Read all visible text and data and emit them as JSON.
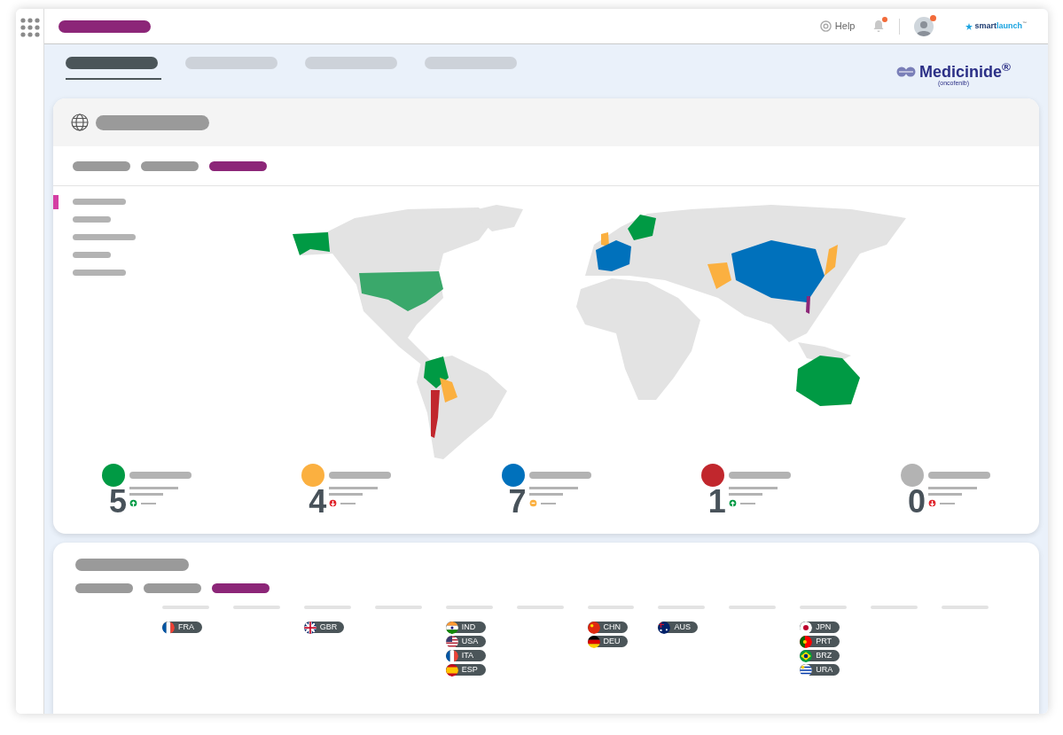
{
  "nav_tabs": [
    {
      "selected": true
    },
    {
      "selected": false
    },
    {
      "selected": false
    },
    {
      "selected": false
    }
  ],
  "top_bar": {
    "help": "Help"
  },
  "partner_logo": {
    "first": "smart",
    "second": "launch",
    "mark": "™"
  },
  "brand": {
    "name": "Medicinide$^{®}$",
    "generic": "(oncofenib)"
  },
  "map_card": {
    "tabs": [
      {
        "selected": false
      },
      {
        "selected": false
      },
      {
        "selected": true
      }
    ],
    "side_list": [
      {
        "selected": true
      },
      {
        "selected": false
      },
      {
        "selected": false
      },
      {
        "selected": false
      },
      {
        "selected": false
      }
    ],
    "stats": [
      {
        "color": "#009a44",
        "value": "5",
        "kind": "up"
      },
      {
        "color": "#fbb040",
        "value": "4",
        "kind": "down"
      },
      {
        "color": "#0071bc",
        "value": "7",
        "kind": "flat"
      },
      {
        "color": "#c1272d",
        "value": "1",
        "kind": "up"
      },
      {
        "color": "#b3b3b3",
        "value": "0",
        "kind": "down"
      }
    ]
  },
  "list_card": {
    "tabs": [
      {
        "selected": false
      },
      {
        "selected": false
      },
      {
        "selected": true
      }
    ],
    "columns": [
      {
        "chips": [
          {
            "kind": "fr",
            "code": "FRA"
          }
        ]
      },
      {},
      {
        "chips": [
          {
            "kind": "gb",
            "code": "GBR"
          }
        ]
      },
      {},
      {
        "chips": [
          {
            "kind": "in",
            "code": "IND"
          },
          {
            "kind": "us",
            "code": "USA"
          },
          {
            "kind": "fr",
            "code": "ITA"
          },
          {
            "kind": "es",
            "code": "ESP"
          }
        ]
      },
      {},
      {
        "chips": [
          {
            "kind": "cn",
            "code": "CHN"
          },
          {
            "kind": "de",
            "code": "DEU"
          }
        ]
      },
      {
        "chips": [
          {
            "kind": "au",
            "code": "AUS"
          }
        ]
      },
      {},
      {
        "chips": [
          {
            "kind": "jp",
            "code": "JPN"
          },
          {
            "kind": "pt",
            "code": "PRT"
          },
          {
            "kind": "br",
            "code": "BRZ"
          },
          {
            "kind": "uy",
            "code": "URA"
          }
        ]
      },
      {},
      {}
    ]
  }
}
